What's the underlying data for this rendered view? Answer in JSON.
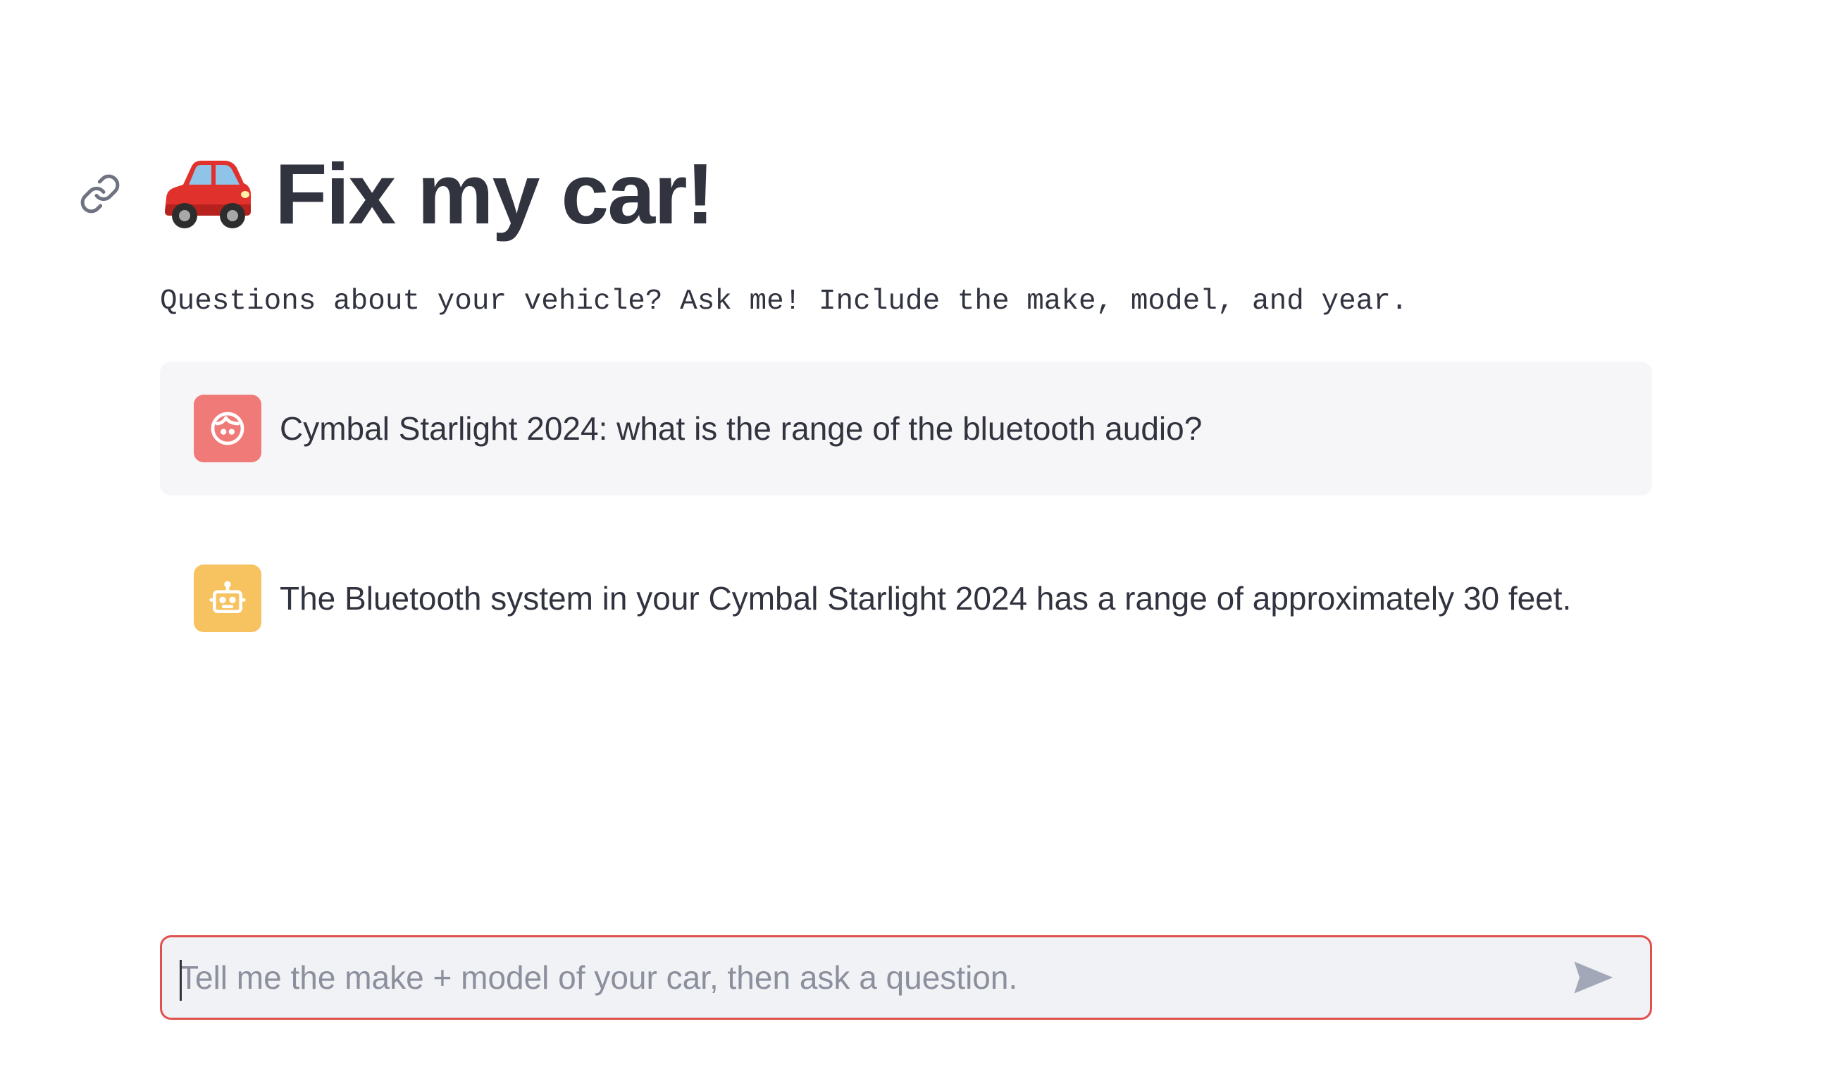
{
  "header": {
    "title": "Fix my car!",
    "emoji": "🚗",
    "subtitle": "Questions about your vehicle? Ask me! Include the make, model, and year."
  },
  "messages": [
    {
      "role": "user",
      "avatar_icon": "user-face-icon",
      "text": "Cymbal Starlight 2024: what is the range of the bluetooth audio?"
    },
    {
      "role": "assistant",
      "avatar_icon": "robot-icon",
      "text": "The Bluetooth system in your Cymbal Starlight 2024 has a range of approximately 30 feet."
    }
  ],
  "chat_input": {
    "placeholder": "Tell me the make + model of your car, then ask a question.",
    "value": "",
    "send_icon": "send-icon"
  },
  "colors": {
    "user_avatar": "#ef7a78",
    "assistant_avatar": "#f7c260",
    "input_border": "#e0504c",
    "text": "#31333f"
  }
}
